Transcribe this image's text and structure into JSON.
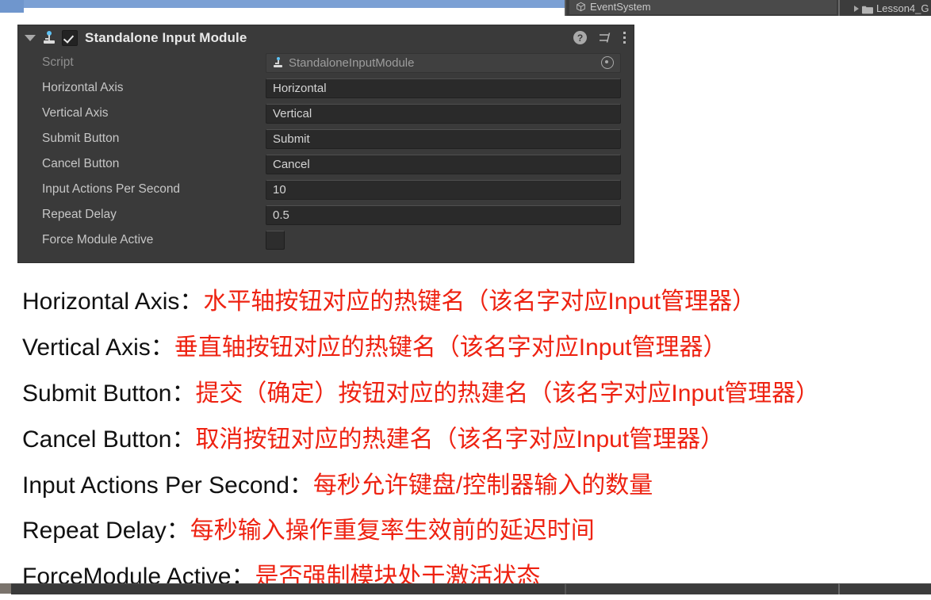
{
  "editor": {
    "hierarchy": {
      "selected_object": "EventSystem",
      "icon": "cube-icon"
    },
    "project": {
      "folder": "Lesson4_G",
      "icon": "folder-icon"
    }
  },
  "inspector": {
    "component": {
      "title": "Standalone Input Module",
      "enabled": true,
      "foldout_expanded": true,
      "icon": "script-joystick-icon",
      "header_icons": {
        "help": "?",
        "help_name": "help-icon",
        "preset": "preset-sliders-icon",
        "menu": "kebab-menu-icon"
      }
    },
    "rows": [
      {
        "label": "Script",
        "value": "StandaloneInputModule",
        "type": "object",
        "readonly": true
      },
      {
        "label": "Horizontal Axis",
        "value": "Horizontal",
        "type": "text"
      },
      {
        "label": "Vertical Axis",
        "value": "Vertical",
        "type": "text"
      },
      {
        "label": "Submit Button",
        "value": "Submit",
        "type": "text"
      },
      {
        "label": "Cancel Button",
        "value": "Cancel",
        "type": "text"
      },
      {
        "label": "Input Actions Per Second",
        "value": "10",
        "type": "number"
      },
      {
        "label": "Repeat Delay",
        "value": "0.5",
        "type": "number"
      },
      {
        "label": "Force Module Active",
        "value": "",
        "type": "checkbox",
        "checked": false
      }
    ]
  },
  "notes": [
    {
      "term": "Horizontal Axis：",
      "desc": "水平轴按钮对应的热键名（该名字对应Input管理器）"
    },
    {
      "term": "Vertical Axis：",
      "desc": "垂直轴按钮对应的热键名（该名字对应Input管理器）"
    },
    {
      "term": "Submit Button：",
      "desc": "提交（确定）按钮对应的热建名（该名字对应Input管理器）"
    },
    {
      "term": "Cancel Button：",
      "desc": "取消按钮对应的热建名（该名字对应Input管理器）"
    },
    {
      "term": "Input Actions Per Second：",
      "desc": "每秒允许键盘/控制器输入的数量"
    },
    {
      "term": "Repeat Delay：",
      "desc": "每秒输入操作重复率生效前的延迟时间"
    },
    {
      "term": "ForceModule Active：",
      "desc": "是否强制模块处于激活状态"
    }
  ],
  "colors": {
    "panel_bg": "#3a3a3a",
    "field_bg": "#2a2a2a",
    "label": "#c6c6c6",
    "accent_red": "#ee2211",
    "hierarchy_blue": "#7ba0d4"
  }
}
